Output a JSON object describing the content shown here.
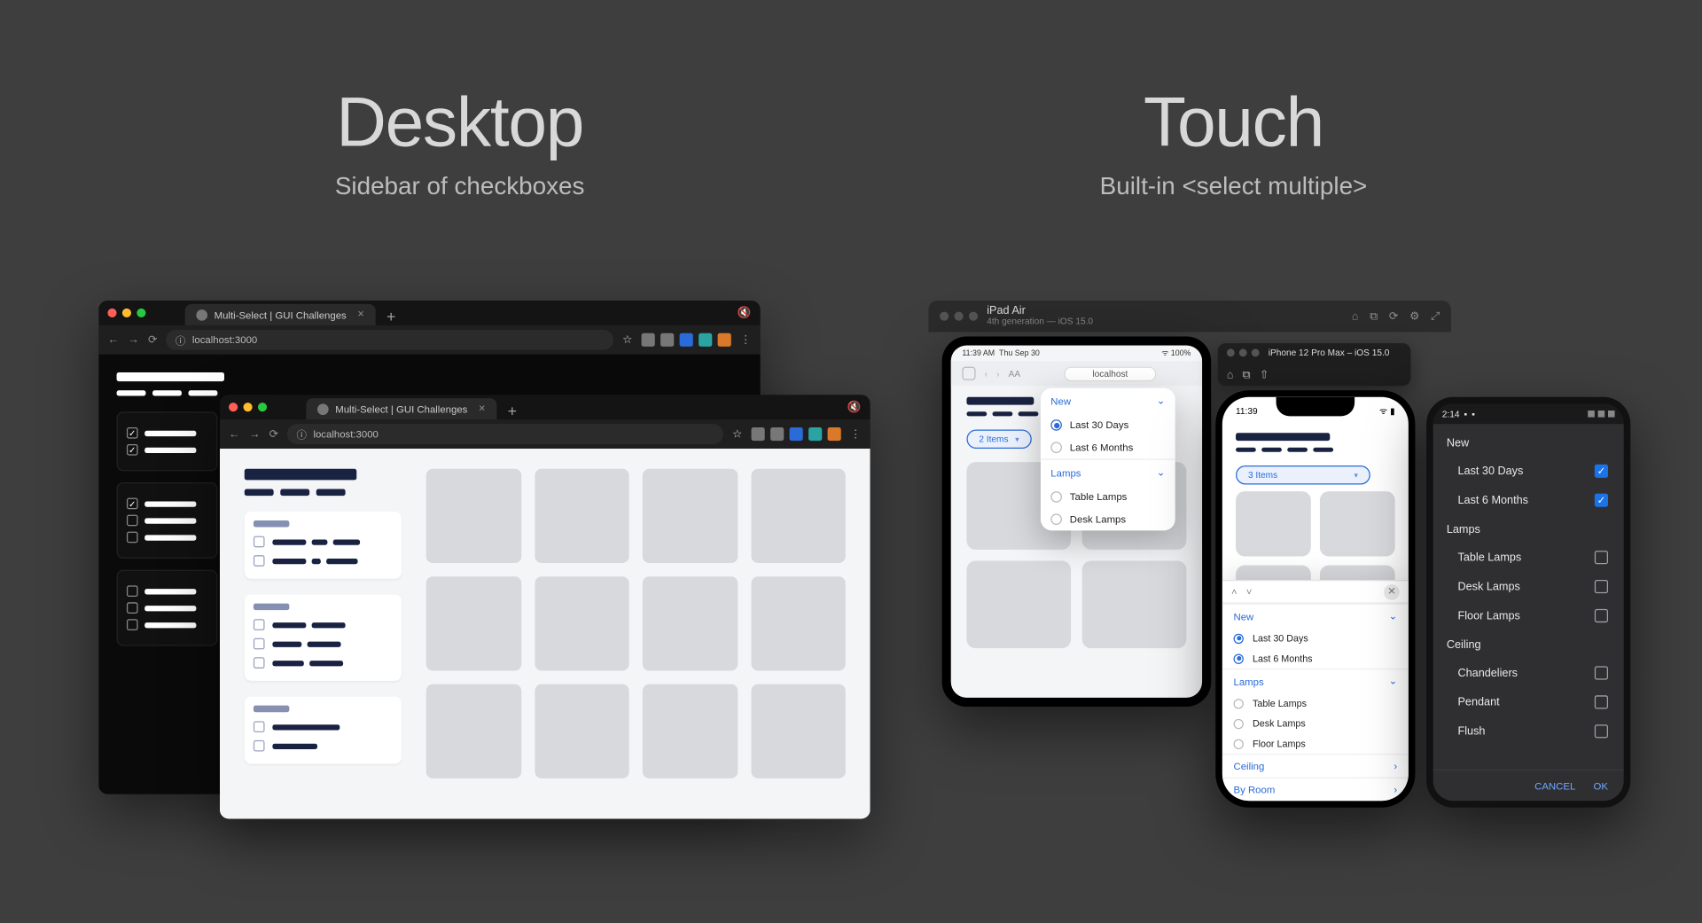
{
  "desktop": {
    "title": "Desktop",
    "subtitle": "Sidebar of checkboxes",
    "browser": {
      "tab_title": "Multi-Select | GUI Challenges",
      "url": "localhost:3000"
    }
  },
  "touch": {
    "title": "Touch",
    "subtitle": "Built-in <select multiple>",
    "ipad_sim": {
      "device": "iPad Air",
      "meta": "4th generation — iOS 15.0",
      "status_time": "11:39 AM",
      "status_date": "Thu Sep 30",
      "safari_url": "localhost",
      "pill_label": "2 Items",
      "popover": {
        "groups": [
          {
            "title": "New",
            "items": [
              {
                "label": "Last 30 Days",
                "selected": true
              },
              {
                "label": "Last 6 Months",
                "selected": false
              }
            ]
          },
          {
            "title": "Lamps",
            "items": [
              {
                "label": "Table Lamps",
                "selected": false
              },
              {
                "label": "Desk Lamps",
                "selected": false
              }
            ]
          }
        ]
      }
    },
    "iphone_sim": {
      "titlebar": "iPhone 12 Pro Max – iOS 15.0",
      "status_time": "11:39",
      "pill_label": "3 Items",
      "sheet": {
        "groups": [
          {
            "title": "New",
            "collapsible": "⌄",
            "items": [
              {
                "label": "Last 30 Days",
                "selected": true
              },
              {
                "label": "Last 6 Months",
                "selected": true
              }
            ]
          },
          {
            "title": "Lamps",
            "collapsible": "⌄",
            "items": [
              {
                "label": "Table Lamps",
                "selected": false
              },
              {
                "label": "Desk Lamps",
                "selected": false
              },
              {
                "label": "Floor Lamps",
                "selected": false
              }
            ]
          },
          {
            "title": "Ceiling",
            "collapsible": "›",
            "items": []
          },
          {
            "title": "By Room",
            "collapsible": "›",
            "items": []
          }
        ]
      }
    },
    "android": {
      "status_time": "2:14",
      "groups": [
        {
          "title": "New",
          "items": [
            {
              "label": "Last 30 Days",
              "checked": true
            },
            {
              "label": "Last 6 Months",
              "checked": true
            }
          ]
        },
        {
          "title": "Lamps",
          "items": [
            {
              "label": "Table Lamps",
              "checked": false
            },
            {
              "label": "Desk Lamps",
              "checked": false
            },
            {
              "label": "Floor Lamps",
              "checked": false
            }
          ]
        },
        {
          "title": "Ceiling",
          "items": [
            {
              "label": "Chandeliers",
              "checked": false
            },
            {
              "label": "Pendant",
              "checked": false
            },
            {
              "label": "Flush",
              "checked": false
            }
          ]
        }
      ],
      "buttons": {
        "cancel": "CANCEL",
        "ok": "OK"
      }
    }
  }
}
